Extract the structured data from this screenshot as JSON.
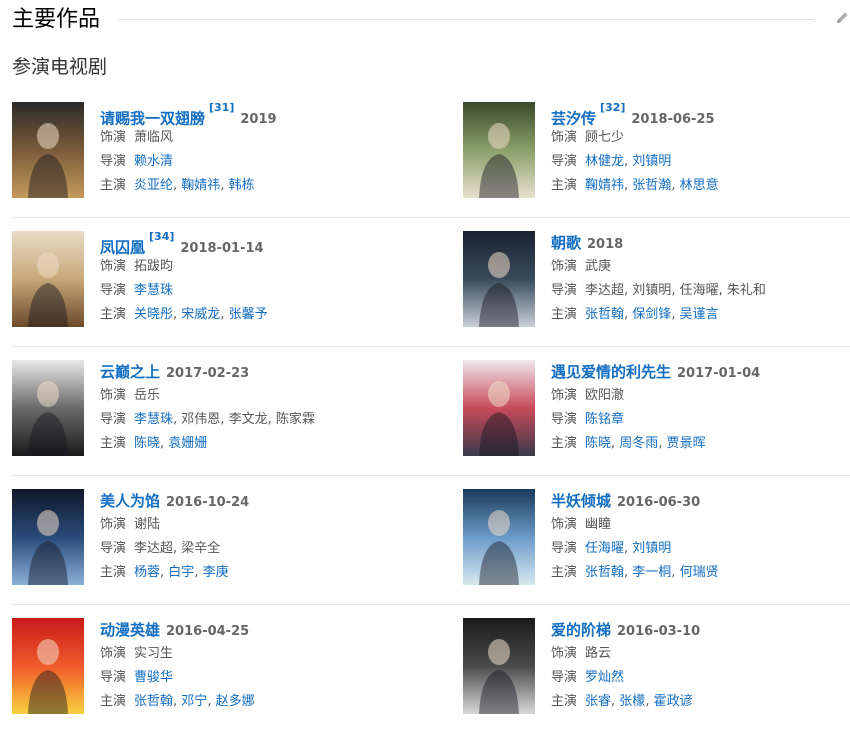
{
  "header": {
    "title": "主要作品",
    "edit_icon": "pencil-icon"
  },
  "subsection": {
    "title": "参演电视剧"
  },
  "labels": {
    "role": "饰演",
    "director": "导演",
    "cast": "主演"
  },
  "works": [
    {
      "title": "请赐我一双翅膀",
      "cite": "[31]",
      "year": "2019",
      "role": "萧临风",
      "directors": [
        {
          "name": "赖水清",
          "link": true
        }
      ],
      "cast": [
        {
          "name": "炎亚纶",
          "link": true
        },
        {
          "name": "鞠婧祎",
          "link": true
        },
        {
          "name": "韩栋",
          "link": true
        }
      ],
      "poster_colors": [
        "#2b2a28",
        "#7a5a3a",
        "#c49a5a"
      ]
    },
    {
      "title": "芸汐传",
      "cite": "[32]",
      "year": "2018-06-25",
      "role": "顾七少",
      "directors": [
        {
          "name": "林健龙",
          "link": true
        },
        {
          "name": "刘镇明",
          "link": true
        }
      ],
      "cast": [
        {
          "name": "鞠婧祎",
          "link": true
        },
        {
          "name": "张哲瀚",
          "link": true
        },
        {
          "name": "林思意",
          "link": true
        }
      ],
      "poster_colors": [
        "#3b4a2a",
        "#8aa06a",
        "#e8e0d0"
      ]
    },
    {
      "title": "凤囚凰",
      "cite": "[34]",
      "year": "2018-01-14",
      "role": "拓跋昀",
      "directors": [
        {
          "name": "李慧珠",
          "link": true
        }
      ],
      "cast": [
        {
          "name": "关晓彤",
          "link": true
        },
        {
          "name": "宋威龙",
          "link": true
        },
        {
          "name": "张馨予",
          "link": true
        }
      ],
      "poster_colors": [
        "#e8dcc8",
        "#c8a878",
        "#6a4a2a"
      ]
    },
    {
      "title": "朝歌",
      "cite": "",
      "year": "2018",
      "role": "武庚",
      "directors": [
        {
          "name": "李达超",
          "link": false
        },
        {
          "name": "刘镇明",
          "link": false
        },
        {
          "name": "任海曜",
          "link": false
        },
        {
          "name": "朱礼和",
          "link": false
        }
      ],
      "cast": [
        {
          "name": "张哲翰",
          "link": true
        },
        {
          "name": "保剑锋",
          "link": true
        },
        {
          "name": "吴谨言",
          "link": true
        }
      ],
      "poster_colors": [
        "#1a2230",
        "#3a4a5a",
        "#c8d0d8"
      ]
    },
    {
      "title": "云巅之上",
      "cite": "",
      "year": "2017-02-23",
      "role": "岳乐",
      "directors": [
        {
          "name": "李慧珠",
          "link": true
        },
        {
          "name": "邓伟恩",
          "link": false
        },
        {
          "name": "李文龙",
          "link": false
        },
        {
          "name": "陈家霖",
          "link": false
        }
      ],
      "cast": [
        {
          "name": "陈晓",
          "link": true
        },
        {
          "name": "袁姗姗",
          "link": true
        }
      ],
      "poster_colors": [
        "#e8e8e8",
        "#6a6a6a",
        "#1a1a1a"
      ]
    },
    {
      "title": "遇见爱情的利先生",
      "cite": "",
      "year": "2017-01-04",
      "role": "欧阳澈",
      "directors": [
        {
          "name": "陈铭章",
          "link": true
        }
      ],
      "cast": [
        {
          "name": "陈晓",
          "link": true
        },
        {
          "name": "周冬雨",
          "link": true
        },
        {
          "name": "贾景晖",
          "link": true
        }
      ],
      "poster_colors": [
        "#f0e8ec",
        "#c84a5a",
        "#3a3a4a"
      ]
    },
    {
      "title": "美人为馅",
      "cite": "",
      "year": "2016-10-24",
      "role": "谢陆",
      "directors": [
        {
          "name": "李达超",
          "link": false
        },
        {
          "name": "梁辛全",
          "link": false
        }
      ],
      "cast": [
        {
          "name": "杨蓉",
          "link": true
        },
        {
          "name": "白宇",
          "link": true
        },
        {
          "name": "李庚",
          "link": true
        }
      ],
      "poster_colors": [
        "#101828",
        "#2a4a7a",
        "#8ab0d8"
      ]
    },
    {
      "title": "半妖倾城",
      "cite": "",
      "year": "2016-06-30",
      "role": "幽瞳",
      "directors": [
        {
          "name": "任海曜",
          "link": true
        },
        {
          "name": "刘镇明",
          "link": true
        }
      ],
      "cast": [
        {
          "name": "张哲翰",
          "link": true
        },
        {
          "name": "李一桐",
          "link": true
        },
        {
          "name": "何瑞贤",
          "link": true
        }
      ],
      "poster_colors": [
        "#1a3a5a",
        "#6a9ac8",
        "#d8e8f0"
      ]
    },
    {
      "title": "动漫英雄",
      "cite": "",
      "year": "2016-04-25",
      "role": "实习生",
      "directors": [
        {
          "name": "曹骏华",
          "link": true
        }
      ],
      "cast": [
        {
          "name": "张哲翰",
          "link": true
        },
        {
          "name": "邓宁",
          "link": true
        },
        {
          "name": "赵多娜",
          "link": true
        }
      ],
      "poster_colors": [
        "#c81a1a",
        "#f05a2a",
        "#f8d040"
      ]
    },
    {
      "title": "爱的阶梯",
      "cite": "",
      "year": "2016-03-10",
      "role": "路云",
      "directors": [
        {
          "name": "罗灿然",
          "link": true
        }
      ],
      "cast": [
        {
          "name": "张睿",
          "link": true
        },
        {
          "name": "张檬",
          "link": true
        },
        {
          "name": "霍政谚",
          "link": true
        }
      ],
      "poster_colors": [
        "#1a1a1a",
        "#4a4a4a",
        "#d8d8d8"
      ]
    }
  ]
}
